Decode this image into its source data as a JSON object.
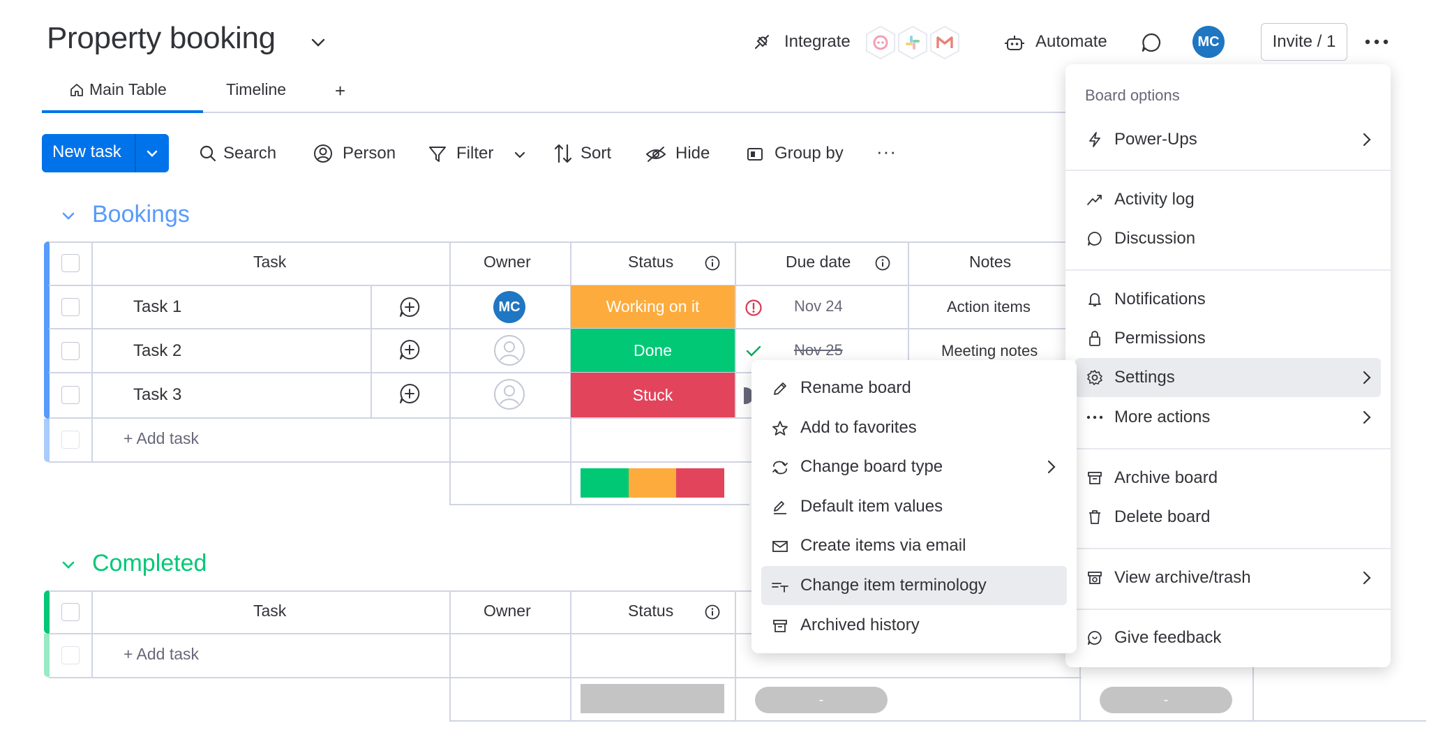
{
  "header": {
    "title": "Property booking",
    "integrate_label": "Integrate",
    "automate_label": "Automate",
    "avatar_initials": "MC",
    "invite_label": "Invite / 1",
    "integration_apps": [
      "monday-app-icon",
      "slack-icon",
      "gmail-icon"
    ]
  },
  "tabs": [
    {
      "label": "Main Table",
      "active": true
    },
    {
      "label": "Timeline",
      "active": false
    }
  ],
  "add_tab_label": "+",
  "toolbar": {
    "new_task_label": "New task",
    "search_label": "Search",
    "person_label": "Person",
    "filter_label": "Filter",
    "sort_label": "Sort",
    "hide_label": "Hide",
    "group_by_label": "Group by",
    "more_label": "···"
  },
  "groups": [
    {
      "title": "Bookings",
      "color": "#579bfc",
      "columns": {
        "task": "Task",
        "owner": "Owner",
        "status": "Status",
        "due_date": "Due date",
        "notes": "Notes"
      },
      "rows": [
        {
          "task": "Task 1",
          "owner": "MC",
          "status": "Working on it",
          "status_color": "#fdab3d",
          "due": "Nov 24",
          "due_state": "overdue",
          "notes": "Action items"
        },
        {
          "task": "Task 2",
          "owner": "",
          "status": "Done",
          "status_color": "#00c875",
          "due": "Nov 25",
          "due_state": "done",
          "notes": "Meeting notes"
        },
        {
          "task": "Task 3",
          "owner": "",
          "status": "Stuck",
          "status_color": "#e2445c",
          "due": "",
          "due_state": "other",
          "notes": ""
        }
      ],
      "add_task_label": "+ Add task",
      "status_summary": [
        {
          "color": "#00c875",
          "fraction": 0.333
        },
        {
          "color": "#fdab3d",
          "fraction": 0.333
        },
        {
          "color": "#e2445c",
          "fraction": 0.334
        }
      ]
    },
    {
      "title": "Completed",
      "color": "#00c875",
      "columns": {
        "task": "Task",
        "owner": "Owner",
        "status": "Status"
      },
      "rows": [],
      "add_task_label": "+ Add task",
      "summary_pills": [
        "-",
        "-"
      ]
    }
  ],
  "board_menu": {
    "heading": "Board options",
    "items": [
      {
        "label": "Power-Ups",
        "icon": "lightning-icon",
        "submenu": true
      },
      {
        "label": "Activity log",
        "icon": "activity-icon",
        "submenu": false
      },
      {
        "label": "Discussion",
        "icon": "chat-bubble-icon",
        "submenu": false
      },
      {
        "label": "Notifications",
        "icon": "bell-icon",
        "submenu": false
      },
      {
        "label": "Permissions",
        "icon": "lock-icon",
        "submenu": false
      },
      {
        "label": "Settings",
        "icon": "gear-icon",
        "submenu": true,
        "highlighted": true
      },
      {
        "label": "More actions",
        "icon": "more-dots-icon",
        "submenu": true
      },
      {
        "label": "Archive board",
        "icon": "archive-icon",
        "submenu": false
      },
      {
        "label": "Delete board",
        "icon": "trash-icon",
        "submenu": false
      },
      {
        "label": "View archive/trash",
        "icon": "archive-trash-icon",
        "submenu": true
      },
      {
        "label": "Give feedback",
        "icon": "feedback-icon",
        "submenu": false
      }
    ]
  },
  "settings_submenu": {
    "items": [
      {
        "label": "Rename board",
        "icon": "pencil-icon",
        "submenu": false
      },
      {
        "label": "Add to favorites",
        "icon": "star-icon",
        "submenu": false
      },
      {
        "label": "Change board type",
        "icon": "swap-icon",
        "submenu": true
      },
      {
        "label": "Default item values",
        "icon": "edit-values-icon",
        "submenu": false
      },
      {
        "label": "Create items via email",
        "icon": "envelope-icon",
        "submenu": false
      },
      {
        "label": "Change item terminology",
        "icon": "terminology-icon",
        "submenu": false,
        "highlighted": true
      },
      {
        "label": "Archived history",
        "icon": "archive-icon",
        "submenu": false
      }
    ]
  }
}
